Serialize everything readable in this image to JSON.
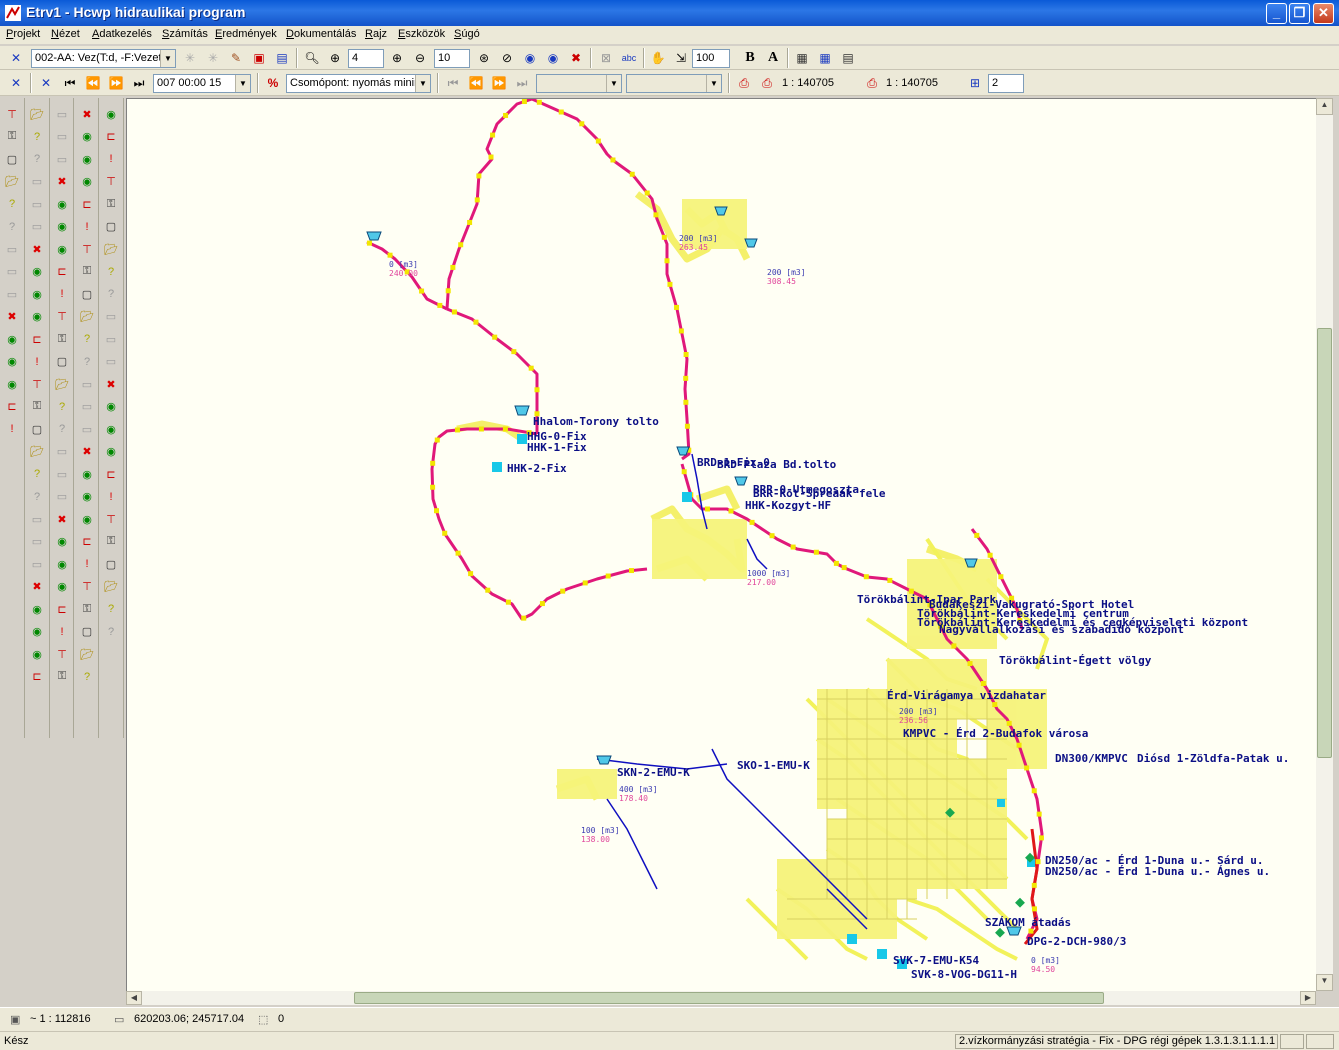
{
  "window": {
    "title": "Etrv1 - Hcwp hidraulikai program"
  },
  "menu": [
    "Projekt",
    "Nézet",
    "Adatkezelés",
    "Számítás",
    "Eredmények",
    "Dokumentálás",
    "Rajz",
    "Eszközök",
    "Súgó"
  ],
  "toolbar1": {
    "layer_combo": "002-AA: Vez(T:d, -F:Vezet",
    "zoom_value": "4",
    "zoom_value2": "10",
    "scale_value": "100",
    "bold_label": "B",
    "text_label": "A"
  },
  "toolbar2": {
    "time_combo": "007   00:00   15",
    "result_combo": "Csomópont: nyomás minim",
    "scale_print1": "1 : 140705",
    "scale_print2": "1 : 140705",
    "count_value": "2"
  },
  "map_labels": [
    "Hhalom-Torony tolto",
    "HHG-0-Fix",
    "HHK-1-Fix",
    "HHK-2-Fix",
    "BRD-1-Fix-0",
    "BRD-Plaza Bd.tolto",
    "BRR-0-Utmegoszta",
    "BRR-Rot-Spreaak fele",
    "HHK-Kozgyt-HF",
    "Törökbálint-Ipar Park",
    "Budakeszi-Vakugrató-Sport Hotel",
    "Törökbálint-Kereskedelmi centrum",
    "Törökbálint-Kereskedelmi és cegképviseleti központ",
    "Nagyvállalkozási és szabadidő központ",
    "Törökbálint-Égett völgy",
    "Érd-Virágamya vizdahatar",
    "SKN-2-EMU-K",
    "SKO-1-EMU-K",
    "KMPVC - Érd 2-Budafok városa",
    "Diósd 1-Zöldfa-Patak u.",
    "DN300/KMPVC",
    "DN250/ac - Érd 1-Duna u.- Sárd u.",
    "DN250/ac - Érd 1-Duna u.- Ágnes u.",
    "SVK-7-EMU-K54",
    "SVK-8-VOG-DG11-H",
    "DPG-2-DCH-980/3",
    "SZÁKOM átadás"
  ],
  "volume_labels": [
    {
      "vol": "0 [m3]",
      "lvl": "240.00"
    },
    {
      "vol": "200 [m3]",
      "lvl": "263.45"
    },
    {
      "vol": "200 [m3]",
      "lvl": "308.45"
    },
    {
      "vol": "1000 [m3]",
      "lvl": "217.00"
    },
    {
      "vol": "400 [m3]",
      "lvl": "178.40"
    },
    {
      "vol": "100 [m3]",
      "lvl": "138.00"
    },
    {
      "vol": "0 [m3]",
      "lvl": "94.50"
    },
    {
      "vol": "200 [m3]",
      "lvl": "236.56"
    }
  ],
  "colors": {
    "main_pipe": "#e0187a",
    "node": "#f2e600",
    "network": "#f4f06a",
    "distribution": "#1010c0",
    "label": "#0b0f85"
  },
  "status": {
    "scale": "~ 1 : 112816",
    "coords": "620203.06; 245717.04",
    "selection": "0",
    "ready": "Kész",
    "strategy": "2.vízkormányzási stratégia - Fix - DPG régi gépek 1.3.1.3.1.1.1.1"
  }
}
